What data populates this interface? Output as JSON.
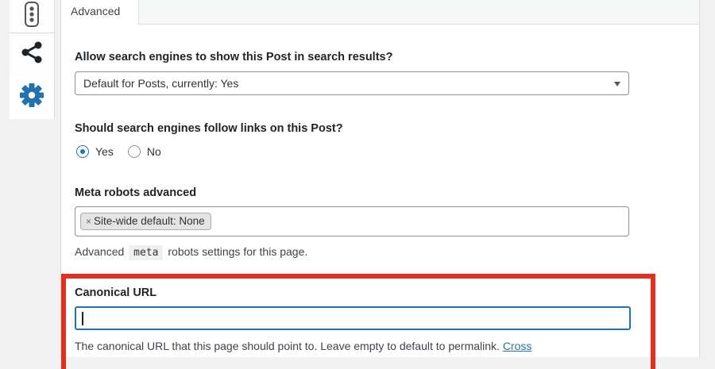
{
  "sidebar": {
    "icons": [
      "traffic-light-icon",
      "share-icon",
      "gear-icon"
    ],
    "active_color": "#2271b1"
  },
  "tabs": [
    {
      "label": "Advanced",
      "active": true
    }
  ],
  "section_search": {
    "label": "Allow search engines to show this Post in search results?",
    "select_value": "Default for Posts, currently: Yes"
  },
  "section_follow": {
    "label": "Should search engines follow links on this Post?",
    "options": [
      {
        "label": "Yes",
        "checked": true
      },
      {
        "label": "No",
        "checked": false
      }
    ]
  },
  "section_meta": {
    "label": "Meta robots advanced",
    "chip_remove": "×",
    "chip_label": "Site-wide default: None",
    "help_before": "Advanced",
    "help_code": "meta",
    "help_after": "robots settings for this page."
  },
  "section_canonical": {
    "label": "Canonical URL",
    "input_value": "",
    "help_text": "The canonical URL that this page should point to. Leave empty to default to permalink.",
    "help_link": "Cross"
  },
  "colors": {
    "highlight_border": "#e62e1f",
    "accent": "#2271b1"
  }
}
